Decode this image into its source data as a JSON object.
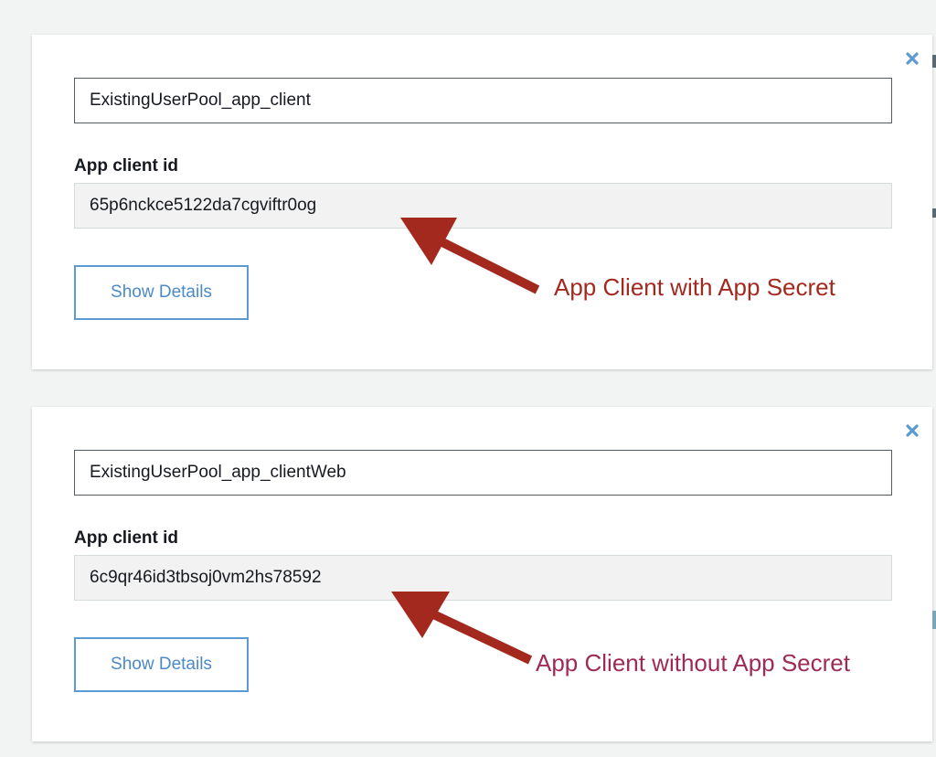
{
  "clients": [
    {
      "name_value": "ExistingUserPool_app_client",
      "id_label": "App client id",
      "id_value": "65p6nckce5122da7cgviftr0og",
      "button_label": "Show Details"
    },
    {
      "name_value": "ExistingUserPool_app_clientWeb",
      "id_label": "App client id",
      "id_value": "6c9qr46id3tbsoj0vm2hs78592",
      "button_label": "Show Details"
    }
  ],
  "annotations": {
    "first": "App Client with App Secret",
    "second": "App Client without App Secret"
  },
  "colors": {
    "accent": "#4a8ac9",
    "close_icon": "#5a9bd3",
    "arrow": "#a3291f",
    "annotation_first": "#a3291f",
    "annotation_second": "#9e2a55"
  },
  "icons": {
    "close": "close-icon",
    "arrow": "arrow-icon"
  }
}
